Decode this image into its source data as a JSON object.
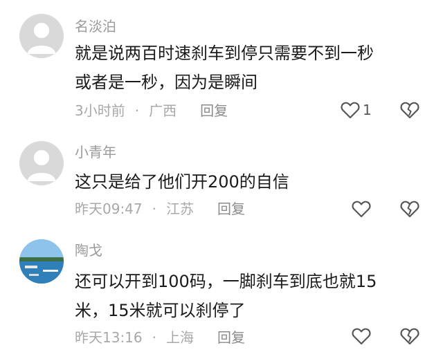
{
  "comments": [
    {
      "user": "名淡泊",
      "text": "就是说两百时速刹车到停只需要不到一秒\n或者是一秒，因为是瞬间",
      "time": "3小时前",
      "location": "广西",
      "reply_label": "回复",
      "like_count": "1",
      "avatar": "default-avatar-icon"
    },
    {
      "user": "小青年",
      "text": "这只是给了他们开200的自信",
      "time": "昨天09:47",
      "location": "江苏",
      "reply_label": "回复",
      "like_count": "",
      "avatar": "default-avatar-icon"
    },
    {
      "user": "陶戈",
      "text": "还可以开到100码，一脚刹车到底也就15\n米，15米就可以刹停了",
      "time": "昨天13:16",
      "location": "上海",
      "reply_label": "回复",
      "like_count": "",
      "avatar": "photo-avatar"
    }
  ],
  "meta_separator": "·",
  "colors": {
    "text": "#1a1a1a",
    "muted": "#a8a8a8",
    "avatar_bg": "#d9d9d9"
  }
}
